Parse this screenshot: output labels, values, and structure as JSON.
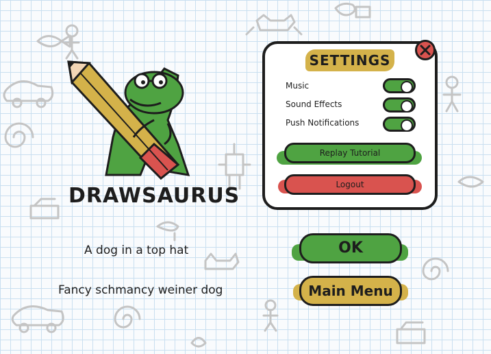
{
  "app": {
    "name": "DRAWSAURUS"
  },
  "settings": {
    "title": "SETTINGS",
    "close_icon": "close-x-icon",
    "options": [
      {
        "label": "Music",
        "enabled": true
      },
      {
        "label": "Sound Effects",
        "enabled": true
      },
      {
        "label": "Push Notifications",
        "enabled": true
      }
    ],
    "replay_tutorial_label": "Replay Tutorial",
    "logout_label": "Logout"
  },
  "prompts": [
    {
      "text": "A dog in a top hat"
    },
    {
      "text": "Fancy schmancy weiner dog"
    }
  ],
  "buttons": {
    "ok_label": "OK",
    "main_menu_label": "Main Menu"
  },
  "colors": {
    "green": "#4fa342",
    "red": "#d9534f",
    "gold": "#d4b24a",
    "ink": "#1d1d1d",
    "grid": "#c9dff0"
  }
}
